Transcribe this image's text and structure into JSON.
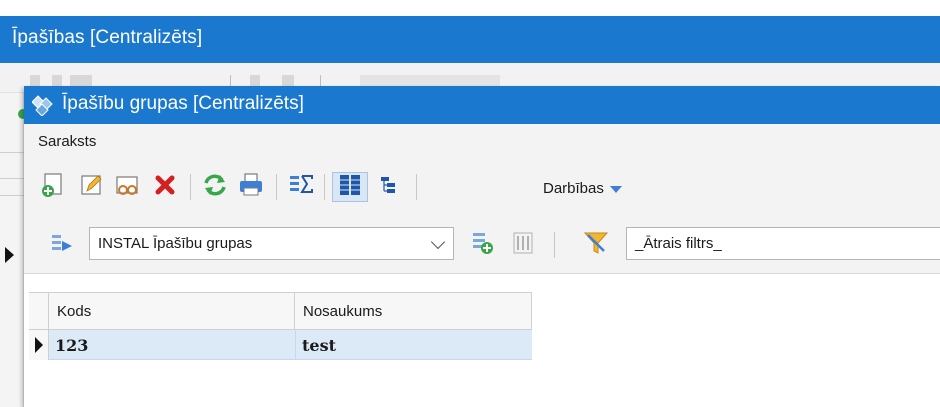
{
  "parent_window": {
    "title": "Īpašības [Centralizēts]"
  },
  "child_window": {
    "title": "Īpašību grupas [Centralizēts]"
  },
  "menu": {
    "items": [
      "Saraksts"
    ]
  },
  "toolbar": {
    "buttons": [
      {
        "name": "add-icon",
        "color": "#3aa64a"
      },
      {
        "name": "edit-icon",
        "color": "#e0a020"
      },
      {
        "name": "view-icon",
        "color": "#c8782a"
      },
      {
        "name": "delete-icon",
        "color": "#d42020"
      },
      {
        "name": "refresh-icon",
        "color": "#3aa64a"
      },
      {
        "name": "print-icon",
        "color": "#3d7fd6"
      },
      {
        "name": "totals-icon",
        "color": "#3d7fd6"
      },
      {
        "name": "columns-icon",
        "color": "#1f56a8"
      },
      {
        "name": "tree-icon",
        "color": "#1f56a8"
      }
    ],
    "actions_label": "Darbības"
  },
  "filter_row": {
    "layout_icon": "layout-select-icon",
    "layout_value": "INSTAL Īpašību grupas",
    "add_layout_icon": "layout-add-icon",
    "layout_settings_icon": "layout-settings-icon",
    "filter_icon": "funnel-icon",
    "quick_filter_value": "_Ātrais filtrs_"
  },
  "grid": {
    "columns": [
      "Kods",
      "Nosaukums"
    ],
    "rows": [
      {
        "kods": "123",
        "nosaukums": "test"
      }
    ]
  },
  "colors": {
    "titlebar": "#1a78cf",
    "selected_row": "#dceaf7"
  }
}
